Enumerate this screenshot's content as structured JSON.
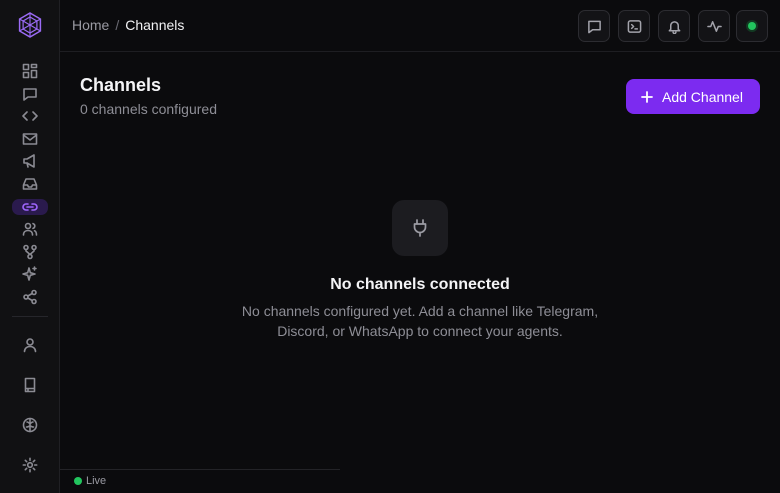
{
  "breadcrumb": {
    "home": "Home",
    "separator": "/",
    "current": "Channels"
  },
  "page": {
    "title": "Channels",
    "subtitle": "0 channels configured"
  },
  "actions": {
    "add_channel_label": "Add Channel"
  },
  "empty_state": {
    "title": "No channels connected",
    "description": "No channels configured yet. Add a channel like Telegram, Discord, or WhatsApp to connect your agents."
  },
  "footer": {
    "live_label": "Live"
  },
  "colors": {
    "accent": "#7c2bf0",
    "status_online": "#22c55e",
    "active_nav": "#a066ff"
  },
  "sidebar": {
    "items": [
      {
        "icon": "dashboard-icon"
      },
      {
        "icon": "chat-icon"
      },
      {
        "icon": "code-icon"
      },
      {
        "icon": "mail-icon"
      },
      {
        "icon": "megaphone-icon"
      },
      {
        "icon": "inbox-icon"
      },
      {
        "icon": "link-icon",
        "active": true
      },
      {
        "icon": "users-icon"
      },
      {
        "icon": "workflow-icon"
      },
      {
        "icon": "sparkles-icon"
      },
      {
        "icon": "share-icon"
      }
    ],
    "bottom_items": [
      {
        "icon": "user-icon"
      },
      {
        "icon": "book-icon"
      },
      {
        "icon": "brain-icon"
      },
      {
        "icon": "settings-icon"
      }
    ]
  },
  "header_buttons": [
    {
      "icon": "message-icon"
    },
    {
      "icon": "terminal-icon"
    },
    {
      "icon": "bell-icon"
    },
    {
      "icon": "activity-icon"
    },
    {
      "icon": "status-indicator"
    }
  ]
}
